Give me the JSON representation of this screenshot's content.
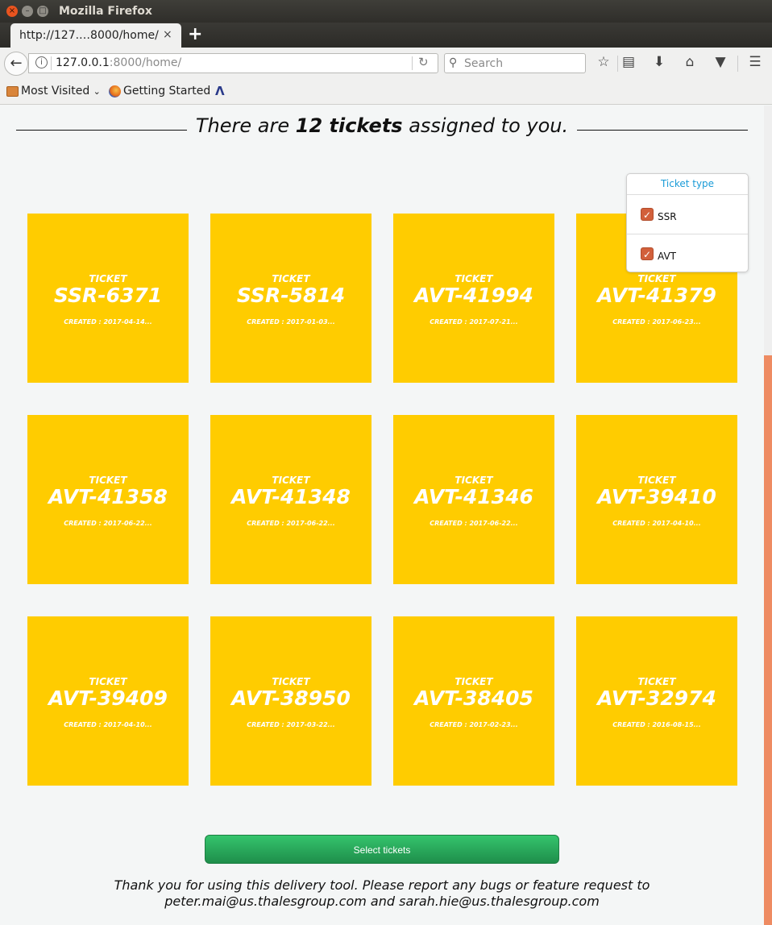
{
  "window": {
    "title": "Mozilla Firefox",
    "close_glyph": "×",
    "min_glyph": "–",
    "max_glyph": "□"
  },
  "tab": {
    "title": "http://127.…8000/home/",
    "close_glyph": "×",
    "new_tab_glyph": "+"
  },
  "navbar": {
    "url_host": "127.0.0.1",
    "url_path": ":8000/home/",
    "search_placeholder": "Search",
    "icons": [
      "back-arrow-icon",
      "info-icon",
      "reload-icon",
      "search-icon",
      "bookmark-star-icon",
      "reading-list-icon",
      "download-icon",
      "home-icon",
      "pocket-icon",
      "hamburger-menu-icon"
    ]
  },
  "bookmarks": {
    "most_visited": "Most Visited",
    "getting_started": "Getting Started"
  },
  "page": {
    "heading_prefix": "There are ",
    "heading_bold": "12 tickets",
    "heading_suffix": " assigned to you.",
    "filter": {
      "title": "Ticket type",
      "options": [
        {
          "label": "SSR",
          "checked": true
        },
        {
          "label": "AVT",
          "checked": true
        }
      ]
    },
    "tickets": [
      {
        "label": "TICKET",
        "id": "SSR-6371",
        "created": "CREATED : 2017-04-14..."
      },
      {
        "label": "TICKET",
        "id": "SSR-5814",
        "created": "CREATED : 2017-01-03..."
      },
      {
        "label": "TICKET",
        "id": "AVT-41994",
        "created": "CREATED : 2017-07-21..."
      },
      {
        "label": "TICKET",
        "id": "AVT-41379",
        "created": "CREATED : 2017-06-23..."
      },
      {
        "label": "TICKET",
        "id": "AVT-41358",
        "created": "CREATED : 2017-06-22..."
      },
      {
        "label": "TICKET",
        "id": "AVT-41348",
        "created": "CREATED : 2017-06-22..."
      },
      {
        "label": "TICKET",
        "id": "AVT-41346",
        "created": "CREATED : 2017-06-22..."
      },
      {
        "label": "TICKET",
        "id": "AVT-39410",
        "created": "CREATED : 2017-04-10..."
      },
      {
        "label": "TICKET",
        "id": "AVT-39409",
        "created": "CREATED : 2017-04-10..."
      },
      {
        "label": "TICKET",
        "id": "AVT-38950",
        "created": "CREATED : 2017-03-22..."
      },
      {
        "label": "TICKET",
        "id": "AVT-38405",
        "created": "CREATED : 2017-02-23..."
      },
      {
        "label": "TICKET",
        "id": "AVT-32974",
        "created": "CREATED : 2016-08-15..."
      }
    ],
    "select_button": "Select tickets",
    "footer_line1": "Thank you for using this delivery tool. Please report any bugs or feature request to",
    "footer_line2": "peter.mai@us.thalesgroup.com and sarah.hie@us.thalesgroup.com"
  },
  "colors": {
    "ticket": "#ffcc00",
    "button": "#27a85a",
    "filter_title": "#1a9bd7",
    "scroll_thumb": "#ee8b62"
  }
}
